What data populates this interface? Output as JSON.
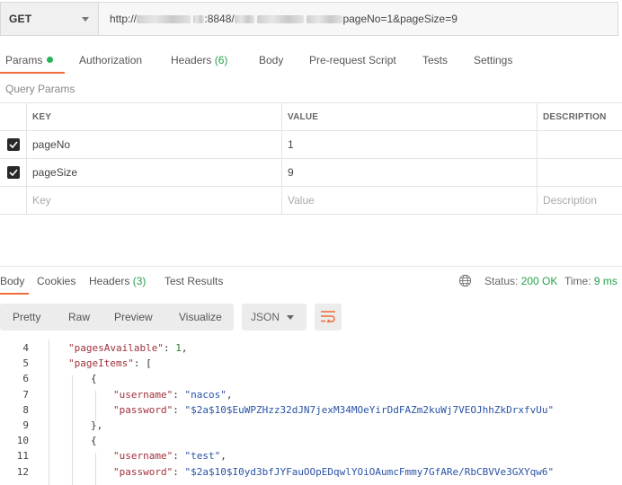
{
  "request": {
    "method": "GET",
    "url_prefix": "http://",
    "url_port_path": ":8848/",
    "url_query": "pageNo=1&pageSize=9"
  },
  "request_tabs": {
    "params": "Params",
    "authorization": "Authorization",
    "headers": "Headers",
    "headers_count": "(6)",
    "body": "Body",
    "prerequest": "Pre-request Script",
    "tests": "Tests",
    "settings": "Settings"
  },
  "query_params": {
    "title": "Query Params",
    "headers": {
      "key": "KEY",
      "value": "VALUE",
      "description": "DESCRIPTION"
    },
    "rows": [
      {
        "checked": true,
        "key": "pageNo",
        "value": "1",
        "description": ""
      },
      {
        "checked": true,
        "key": "pageSize",
        "value": "9",
        "description": ""
      }
    ],
    "placeholder": {
      "key": "Key",
      "value": "Value",
      "description": "Description"
    }
  },
  "response_tabs": {
    "body": "Body",
    "cookies": "Cookies",
    "headers": "Headers",
    "headers_count": "(3)",
    "test_results": "Test Results"
  },
  "response_status": {
    "status_label": "Status:",
    "status_value": "200 OK",
    "time_label": "Time:",
    "time_value": "9 ms"
  },
  "response_toolbar": {
    "pretty": "Pretty",
    "raw": "Raw",
    "preview": "Preview",
    "visualize": "Visualize",
    "format": "JSON"
  },
  "code_lines": [
    {
      "no": "4",
      "indent": 1,
      "key": "\"pagesAvailable\"",
      "sep": ": ",
      "value": "1",
      "vtype": "n",
      "tail": ","
    },
    {
      "no": "5",
      "indent": 1,
      "key": "\"pageItems\"",
      "sep": ": ",
      "value": "",
      "vtype": "s",
      "tail": "["
    },
    {
      "no": "6",
      "indent": 2,
      "key": "",
      "sep": "",
      "value": "",
      "vtype": "s",
      "tail": "{"
    },
    {
      "no": "7",
      "indent": 3,
      "key": "\"username\"",
      "sep": ": ",
      "value": "\"nacos\"",
      "vtype": "s",
      "tail": ","
    },
    {
      "no": "8",
      "indent": 3,
      "key": "\"password\"",
      "sep": ": ",
      "value": "\"$2a$10$EuWPZHzz32dJN7jexM34MOeYirDdFAZm2kuWj7VEOJhhZkDrxfvUu\"",
      "vtype": "s",
      "tail": ""
    },
    {
      "no": "9",
      "indent": 2,
      "key": "",
      "sep": "",
      "value": "",
      "vtype": "s",
      "tail": "},"
    },
    {
      "no": "10",
      "indent": 2,
      "key": "",
      "sep": "",
      "value": "",
      "vtype": "s",
      "tail": "{"
    },
    {
      "no": "11",
      "indent": 3,
      "key": "\"username\"",
      "sep": ": ",
      "value": "\"test\"",
      "vtype": "s",
      "tail": ","
    },
    {
      "no": "12",
      "indent": 3,
      "key": "\"password\"",
      "sep": ": ",
      "value": "\"$2a$10$I0yd3bfJYFauOOpEDqwlYOiOAumcFmmy7GfARe/RbCBVVe3GXYqw6\"",
      "vtype": "s",
      "tail": ""
    }
  ],
  "icons": {
    "method_dropdown": "chevron-down-icon",
    "param_check": "check-icon",
    "network": "globe-icon",
    "format_dropdown": "chevron-down-icon",
    "wrap_lines": "wrap-lines-icon"
  },
  "colors": {
    "accent": "#f26b3a",
    "status_ok": "#26a14a",
    "json_key": "#a0313c",
    "json_string": "#2a52a6",
    "json_number": "#2e7d32"
  }
}
